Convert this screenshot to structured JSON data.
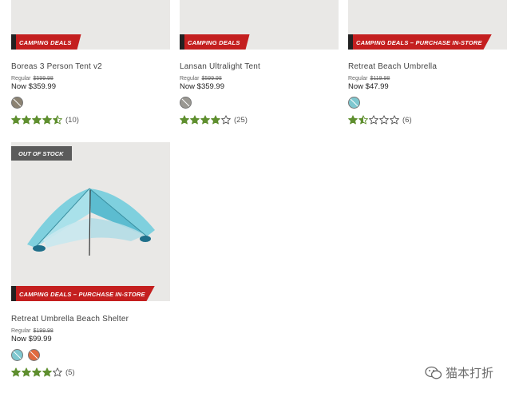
{
  "products": [
    {
      "name": "Boreas 3 Person Tent v2",
      "deal": "CAMPING DEALS",
      "regular_label": "Regular",
      "regular_price": "$599.98",
      "now_label": "Now",
      "now_price": "$359.99",
      "swatches": [
        "#8b8272"
      ],
      "rating": 4.5,
      "review_count": "(10)"
    },
    {
      "name": "Lansan Ultralight Tent",
      "deal": "CAMPING DEALS",
      "regular_label": "Regular",
      "regular_price": "$599.98",
      "now_label": "Now",
      "now_price": "$359.99",
      "swatches": [
        "#9a9892"
      ],
      "rating": 4,
      "review_count": "(25)"
    },
    {
      "name": "Retreat Beach Umbrella",
      "deal": "CAMPING DEALS – PURCHASE IN-STORE",
      "regular_label": "Regular",
      "regular_price": "$119.98",
      "now_label": "Now",
      "now_price": "$47.99",
      "swatches": [
        "#7ec7cf"
      ],
      "rating": 1.5,
      "review_count": "(6)"
    },
    {
      "name": "Retreat Umbrella Beach Shelter",
      "deal": "CAMPING DEALS – PURCHASE IN-STORE",
      "badge": "OUT OF STOCK",
      "regular_label": "Regular",
      "regular_price": "$199.98",
      "now_label": "Now",
      "now_price": "$99.99",
      "swatches": [
        "#7ec7cf",
        "#e06a3e"
      ],
      "rating": 4,
      "review_count": "(5)"
    }
  ],
  "watermark": "猫本打折",
  "colors": {
    "star": "#5f8f2f",
    "deal_red": "#c41f1f"
  }
}
